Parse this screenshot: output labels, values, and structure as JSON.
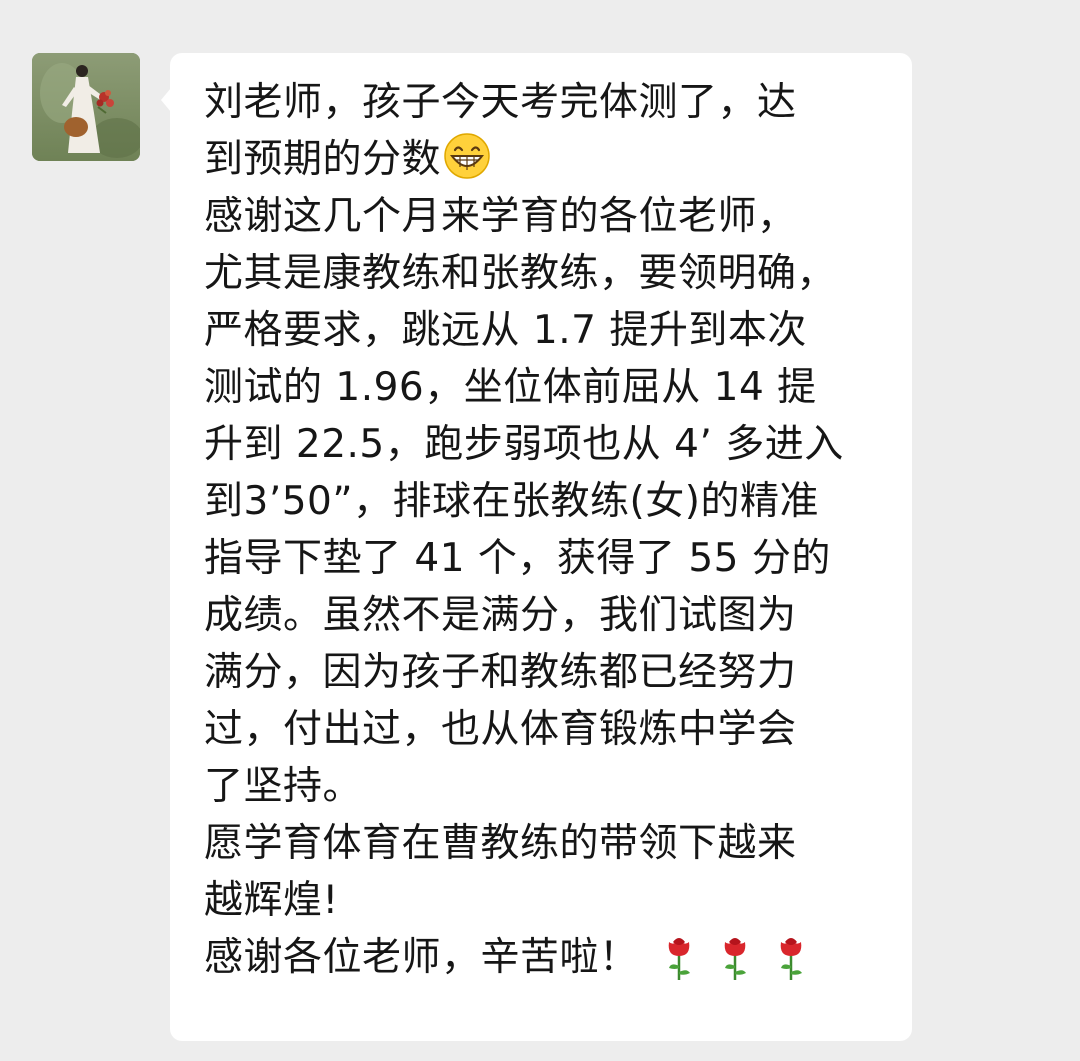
{
  "chat": {
    "sender_avatar": "avatar-woman-with-flowers",
    "message_lines": [
      "刘老师，孩子今天考完体测了，达",
      "到预期的分数",
      "感谢这几个月来学育的各位老师，",
      "尤其是康教练和张教练，要领明确，",
      "严格要求，跳远从 1.7 提升到本次",
      "测试的 1.96，坐位体前屈从 14 提",
      "升到 22.5，跑步弱项也从 4’ 多进入",
      "到3’50”，排球在张教练(女)的精准",
      "指导下垫了 41 个，获得了 55 分的",
      "成绩。虽然不是满分，我们试图为",
      "满分，因为孩子和教练都已经努力",
      "过，付出过，也从体育锻炼中学会",
      "了坚持。",
      "愿学育体育在曹教练的带领下越来",
      "越辉煌!",
      "感谢各位老师，辛苦啦！"
    ],
    "emoji_after_line_2": "grinning-face-emoji",
    "roses_after_last_line": [
      "rose-emoji",
      "rose-emoji",
      "rose-emoji"
    ],
    "colors": {
      "background": "#ededed",
      "bubble": "#ffffff",
      "text": "#161616",
      "rose": "#d9262c"
    }
  }
}
